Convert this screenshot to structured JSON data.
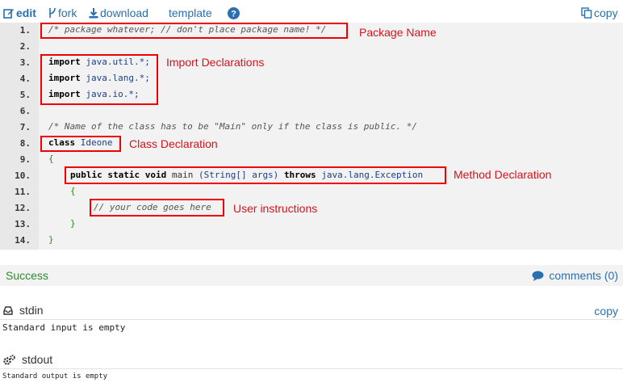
{
  "toolbar": {
    "edit": "edit",
    "fork": "fork",
    "download": "download",
    "template": "template",
    "help_icon": "help-icon",
    "copy": "copy"
  },
  "code": {
    "lines": [
      {
        "num": "1."
      },
      {
        "num": "2."
      },
      {
        "num": "3."
      },
      {
        "num": "4."
      },
      {
        "num": "5."
      },
      {
        "num": "6."
      },
      {
        "num": "7."
      },
      {
        "num": "8."
      },
      {
        "num": "9."
      },
      {
        "num": "10."
      },
      {
        "num": "11."
      },
      {
        "num": "12."
      },
      {
        "num": "13."
      },
      {
        "num": "14."
      }
    ],
    "l1_comment": "/* package whatever; // don't place package name! */",
    "import_kw": "import",
    "import1": "java.util.*;",
    "import2": "java.lang.*;",
    "import3": "java.io.*;",
    "l7_comment": "/* Name of the class has to be \"Main\" only if the class is public. */",
    "class_kw": "class",
    "class_name": "Ideone",
    "open_brace": "{",
    "close_brace": "}",
    "method_mods": "public static void",
    "method_name": "main",
    "method_params": "(String[] args)",
    "throws_kw": "throws",
    "exception": "java.lang.Exception",
    "user_comment": "// your code goes here"
  },
  "annotations": {
    "package_name": "Package Name",
    "import_declarations": "Import Declarations",
    "class_declaration": "Class Declaration",
    "method_declaration": "Method Declaration",
    "user_instructions": "User instructions"
  },
  "status": {
    "result": "Success",
    "comments": "comments (0)"
  },
  "stdin": {
    "title": "stdin",
    "copy": "copy",
    "content": "Standard input is empty"
  },
  "stdout": {
    "title": "stdout",
    "content": "Standard output is empty"
  },
  "colors": {
    "link": "#2a6fb0",
    "success": "#2d8a2d",
    "annotation": "#d4141c"
  }
}
